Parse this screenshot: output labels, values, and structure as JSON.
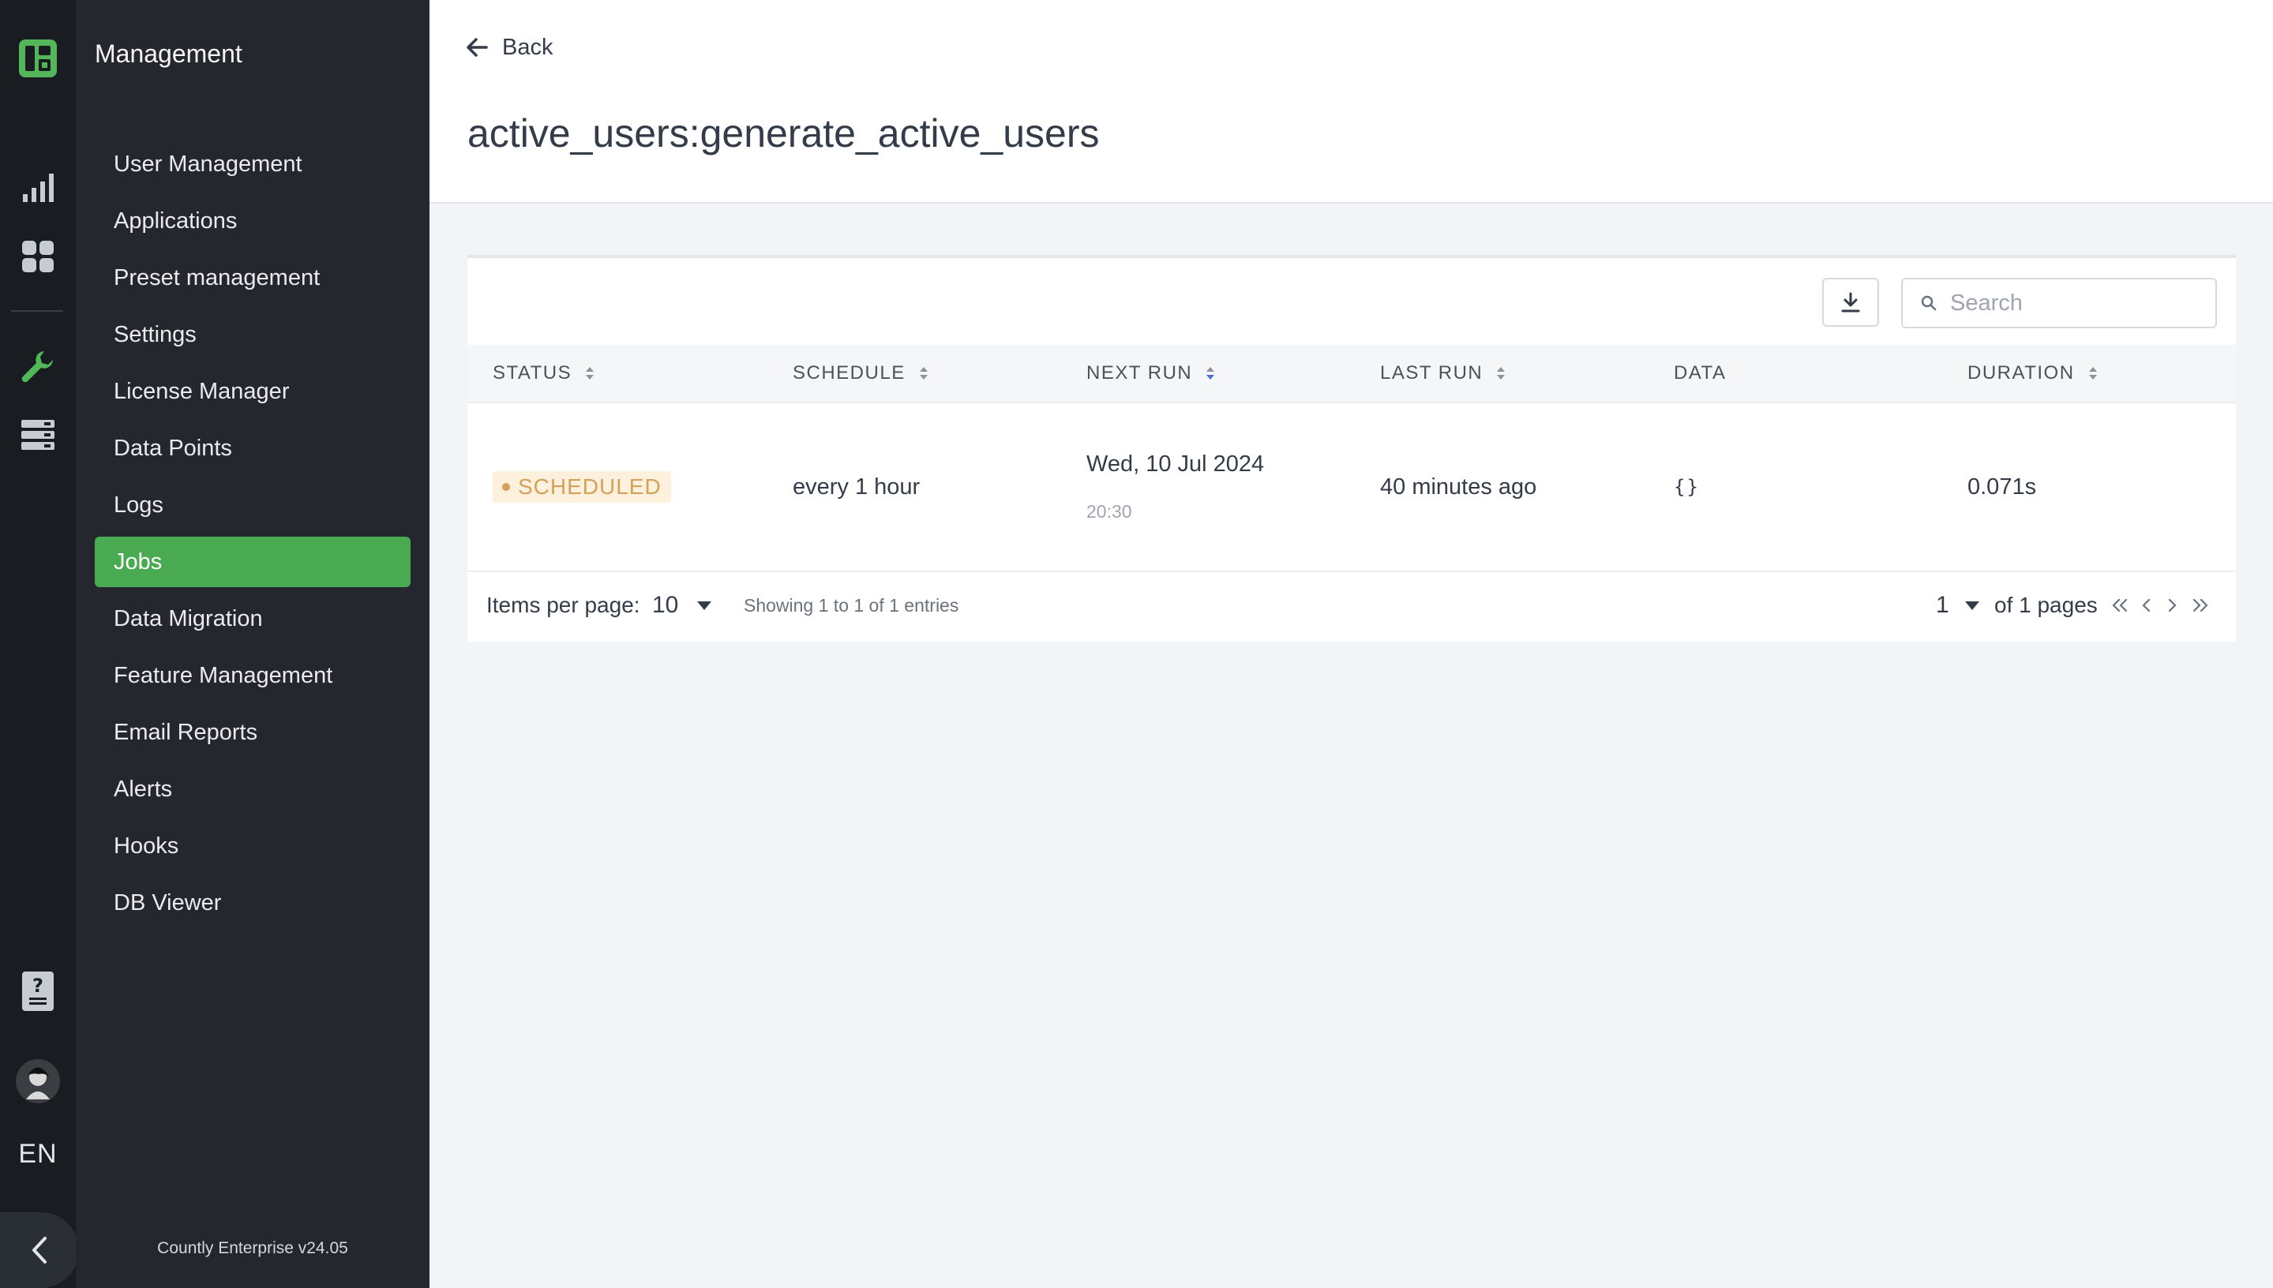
{
  "app": {
    "section_title": "Management",
    "version": "Countly Enterprise v24.05",
    "language": "EN"
  },
  "rail": {
    "icons": [
      "logo-icon",
      "analytics-icon",
      "dashboards-icon",
      "management-wrench-icon",
      "data-manager-icon",
      "help-icon",
      "user-avatar"
    ]
  },
  "sidebar": {
    "items": [
      {
        "label": "User Management"
      },
      {
        "label": "Applications"
      },
      {
        "label": "Preset management"
      },
      {
        "label": "Settings"
      },
      {
        "label": "License Manager"
      },
      {
        "label": "Data Points"
      },
      {
        "label": "Logs"
      },
      {
        "label": "Jobs",
        "active": true
      },
      {
        "label": "Data Migration"
      },
      {
        "label": "Feature Management"
      },
      {
        "label": "Email Reports"
      },
      {
        "label": "Alerts"
      },
      {
        "label": "Hooks"
      },
      {
        "label": "DB Viewer"
      }
    ]
  },
  "header": {
    "back_label": "Back",
    "title": "active_users:generate_active_users"
  },
  "toolbar": {
    "search_placeholder": "Search"
  },
  "table": {
    "columns": [
      {
        "label": "STATUS",
        "sortable": true
      },
      {
        "label": "SCHEDULE",
        "sortable": true
      },
      {
        "label": "NEXT RUN",
        "sortable": true,
        "sorted": true
      },
      {
        "label": "LAST RUN",
        "sortable": true
      },
      {
        "label": "DATA",
        "sortable": false
      },
      {
        "label": "DURATION",
        "sortable": true
      }
    ],
    "rows": [
      {
        "status": "SCHEDULED",
        "schedule": "every 1 hour",
        "next_run_date": "Wed, 10 Jul 2024",
        "next_run_time": "20:30",
        "last_run": "40 minutes ago",
        "data": "{}",
        "duration": "0.071s"
      }
    ]
  },
  "pagination": {
    "items_per_page_label": "Items per page:",
    "items_per_page": "10",
    "showing": "Showing 1 to 1 of 1 entries",
    "current_page": "1",
    "of_pages": "of 1 pages"
  },
  "colors": {
    "accent": "#4aaa51",
    "status_scheduled": "#d4a05a",
    "status_scheduled_bg": "#fdf1de",
    "sort_active": "#4f6fd6"
  }
}
